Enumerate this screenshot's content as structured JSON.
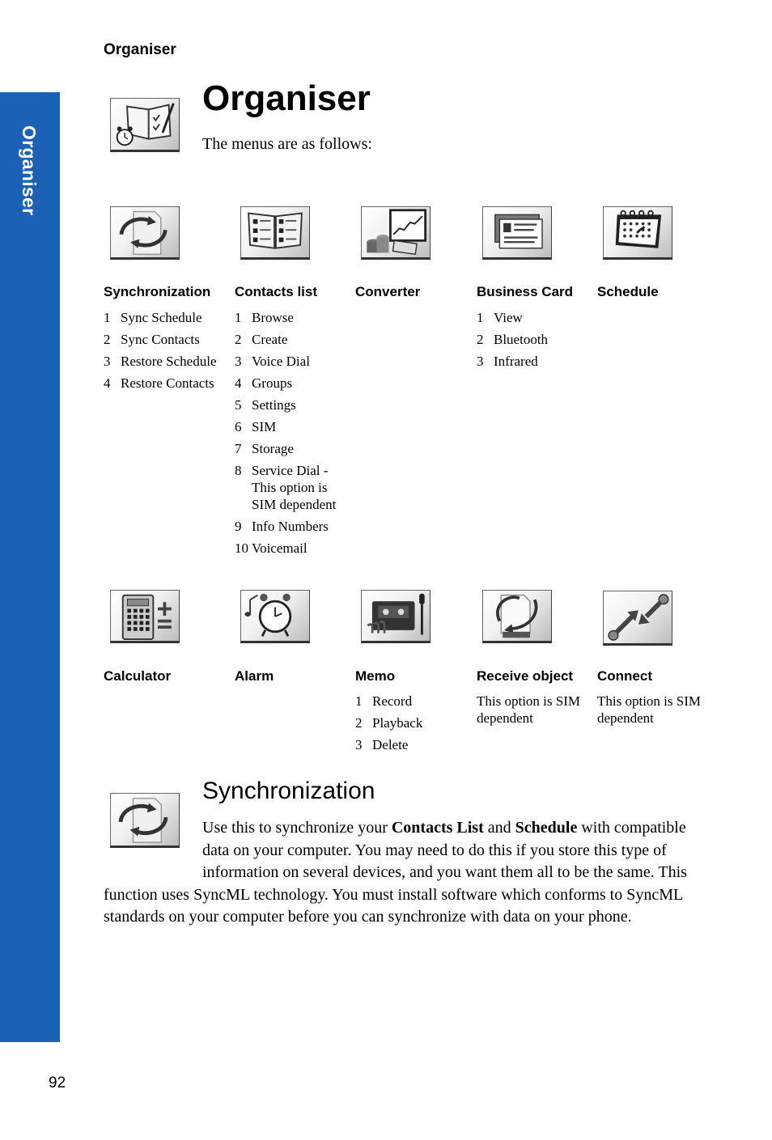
{
  "header": {
    "running_title": "Organiser"
  },
  "side_tab": {
    "label": "Organiser",
    "color": "#1b62b7"
  },
  "section": {
    "title": "Organiser",
    "intro": "The menus are as follows:",
    "icon": "organiser-book-alarm-icon"
  },
  "menus_row1": [
    {
      "icon": "synchronization-icon",
      "title": "Synchronization",
      "items": [
        {
          "num": "1",
          "text": "Sync Schedule"
        },
        {
          "num": "2",
          "text": "Sync Contacts"
        },
        {
          "num": "3",
          "text": "Restore Schedule"
        },
        {
          "num": "4",
          "text": "Restore Contacts"
        }
      ]
    },
    {
      "icon": "contacts-list-icon",
      "title": "Contacts list",
      "items": [
        {
          "num": "1",
          "text": "Browse"
        },
        {
          "num": "2",
          "text": "Create"
        },
        {
          "num": "3",
          "text": "Voice Dial"
        },
        {
          "num": "4",
          "text": "Groups"
        },
        {
          "num": "5",
          "text": "Settings"
        },
        {
          "num": "6",
          "text": "SIM"
        },
        {
          "num": "7",
          "text": "Storage"
        },
        {
          "num": "8",
          "text": "Service Dial -\nThis option is\nSIM dependent"
        },
        {
          "num": "9",
          "text": "Info Numbers"
        },
        {
          "num": "10",
          "text": "Voicemail"
        }
      ]
    },
    {
      "icon": "converter-icon",
      "title": "Converter",
      "items": []
    },
    {
      "icon": "business-card-icon",
      "title": "Business Card",
      "items": [
        {
          "num": "1",
          "text": "View"
        },
        {
          "num": "2",
          "text": "Bluetooth"
        },
        {
          "num": "3",
          "text": "Infrared"
        }
      ]
    },
    {
      "icon": "schedule-calendar-icon",
      "title": "Schedule",
      "items": []
    }
  ],
  "menus_row2": [
    {
      "icon": "calculator-icon",
      "title": "Calculator",
      "items": []
    },
    {
      "icon": "alarm-clock-icon",
      "title": "Alarm",
      "items": []
    },
    {
      "icon": "memo-recorder-icon",
      "title": "Memo",
      "items": [
        {
          "num": "1",
          "text": "Record"
        },
        {
          "num": "2",
          "text": "Playback"
        },
        {
          "num": "3",
          "text": "Delete"
        }
      ]
    },
    {
      "icon": "receive-object-icon",
      "title": "Receive object",
      "note": "This option is SIM dependent"
    },
    {
      "icon": "connect-icon",
      "title": "Connect",
      "note": "This option is SIM dependent"
    }
  ],
  "sync_section": {
    "title": "Synchronization",
    "icon": "synchronization-icon",
    "paragraph": {
      "part1": "Use this to synchronize your ",
      "bold1": "Contacts List",
      "part2": " and ",
      "bold2": "Schedule",
      "part3": " with compatible data on your computer. You may need to do this if you store this type of information on several devices, and you want them all to be the same. This function uses SyncML technology. You must install software which conforms to SyncML standards on your computer before you can synchronize with data on your phone."
    }
  },
  "footer": {
    "page_number": "92"
  }
}
